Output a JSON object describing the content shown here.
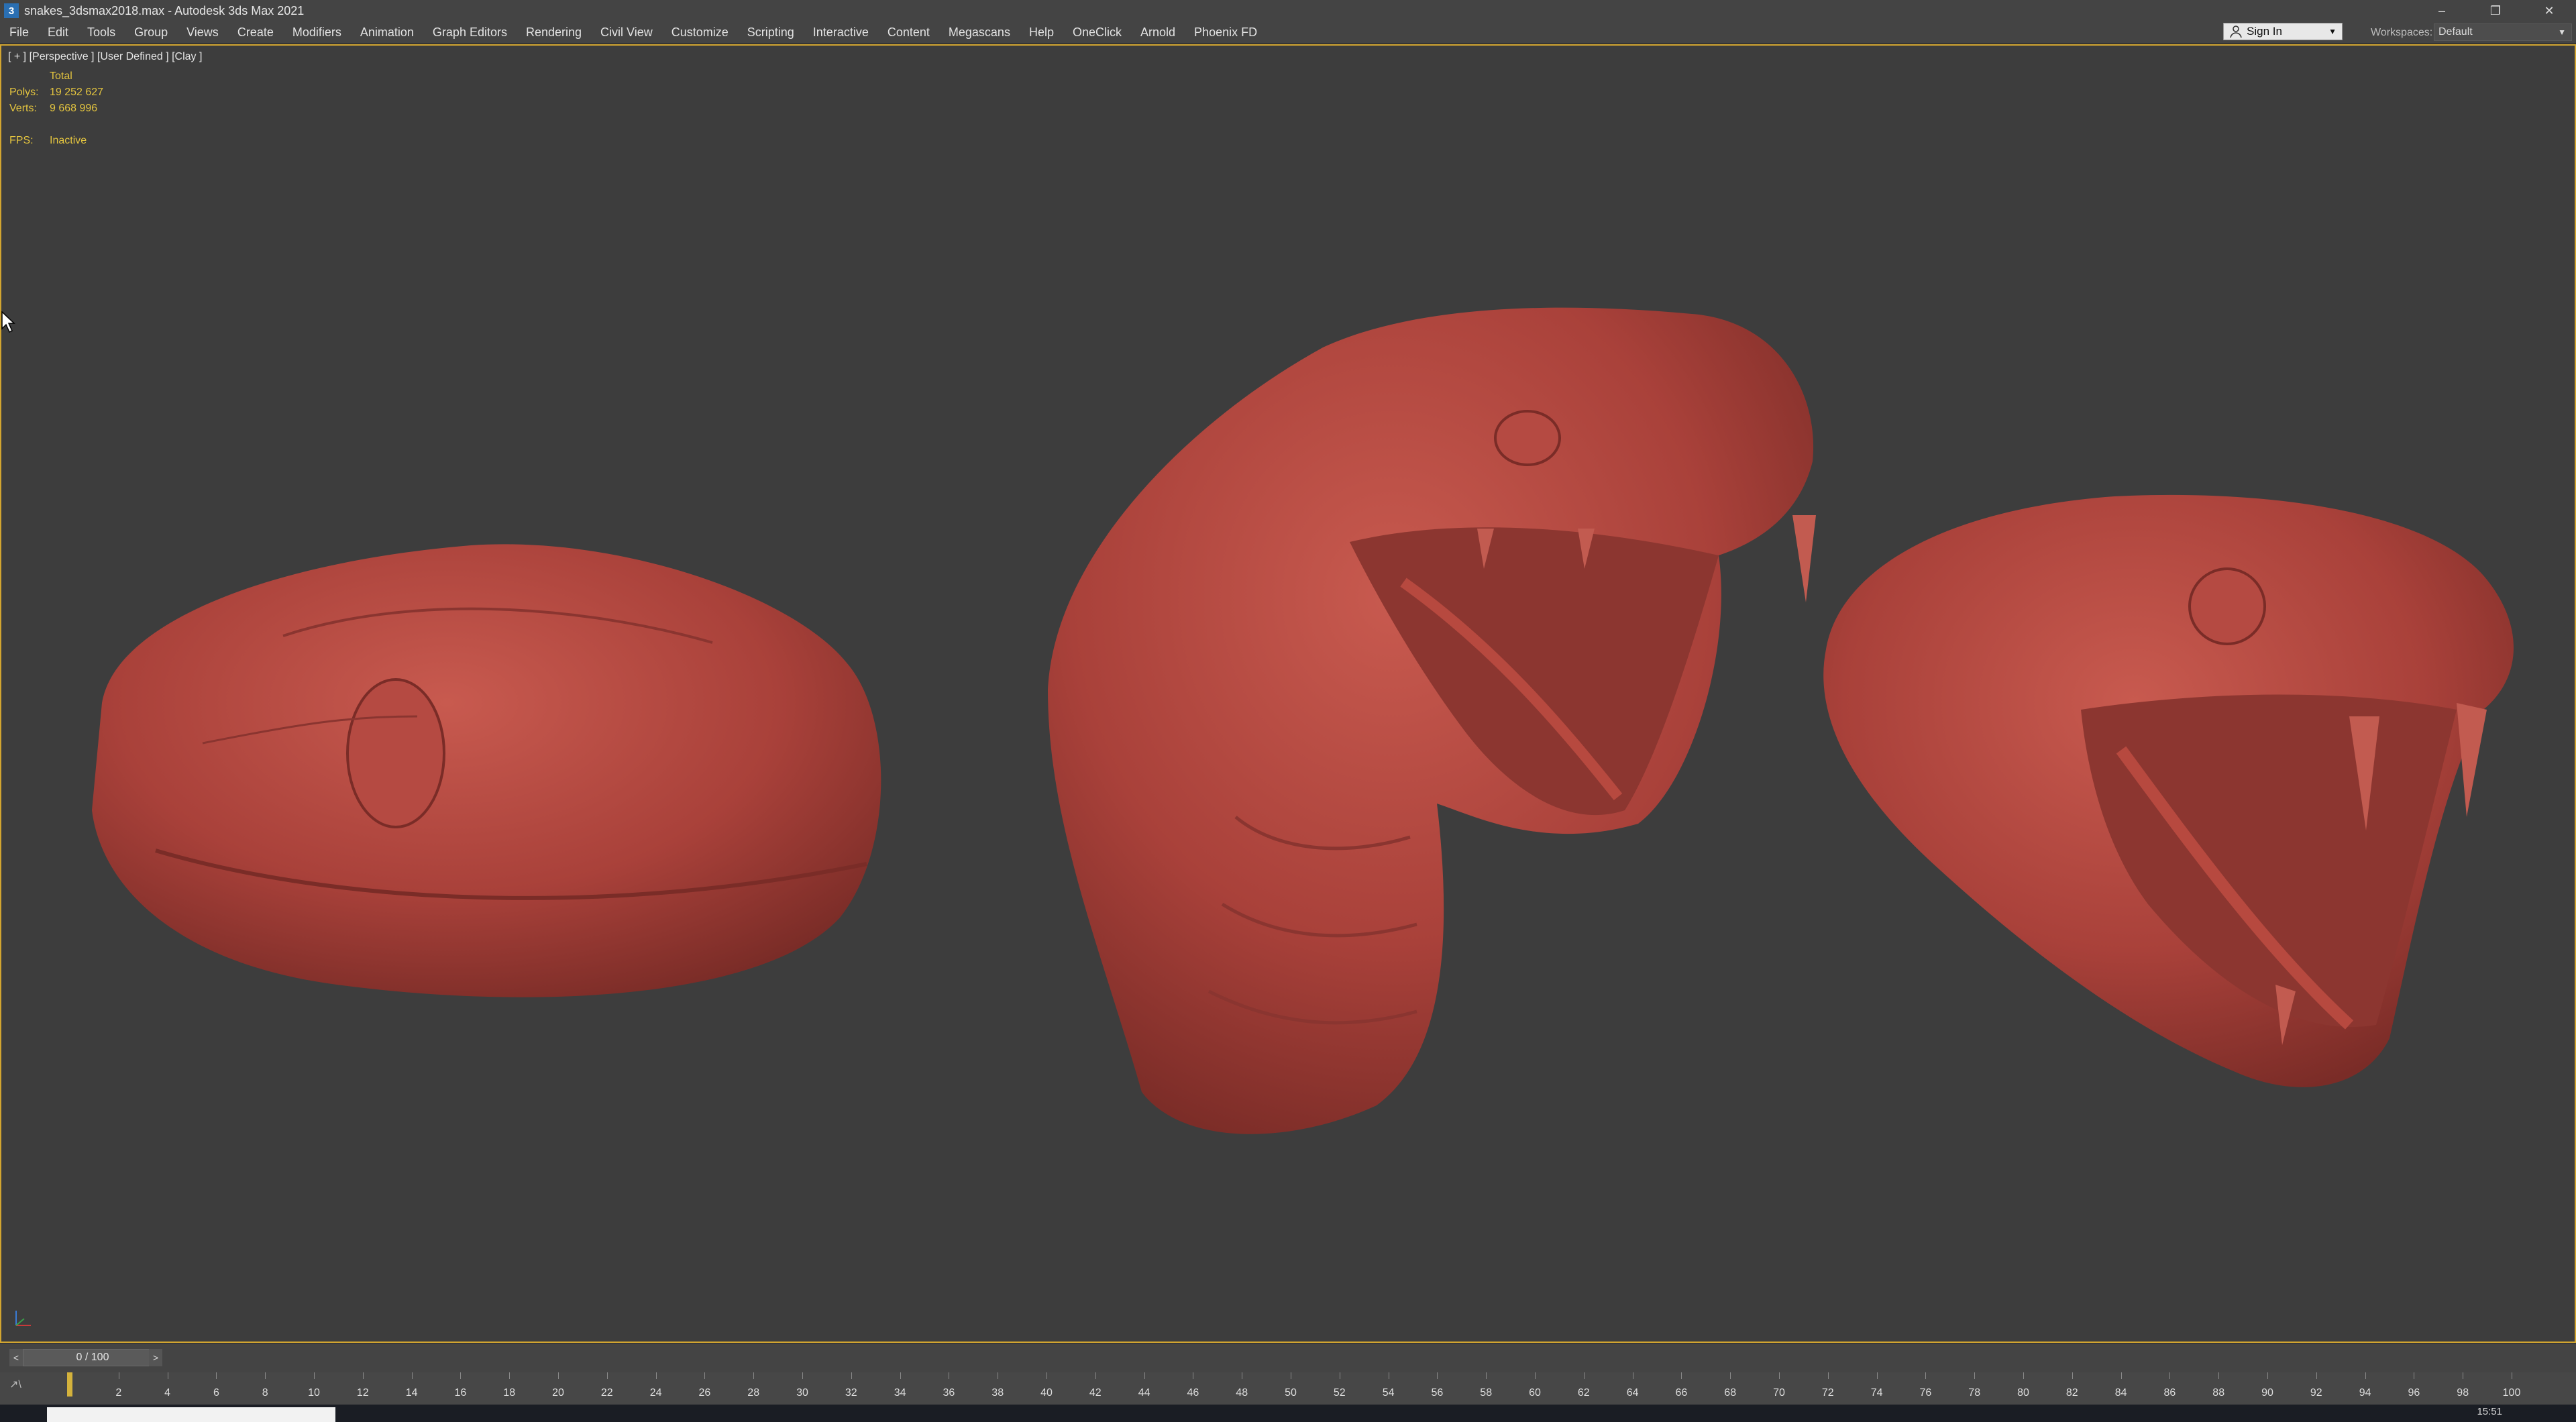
{
  "window": {
    "app_icon": "3",
    "title": "snakes_3dsmax2018.max - Autodesk 3ds Max 2021",
    "minimize": "–",
    "restore": "❐",
    "close": "✕"
  },
  "menu": {
    "items": [
      "File",
      "Edit",
      "Tools",
      "Group",
      "Views",
      "Create",
      "Modifiers",
      "Animation",
      "Graph Editors",
      "Rendering",
      "Civil View",
      "Customize",
      "Scripting",
      "Interactive",
      "Content",
      "Megascans",
      "Help",
      "OneClick",
      "Arnold",
      "Phoenix FD"
    ]
  },
  "account": {
    "sign_in": "Sign In",
    "dropdown_arrow": "▼"
  },
  "workspace": {
    "label": "Workspaces:",
    "value": "Default",
    "dropdown_arrow": "▼"
  },
  "viewport": {
    "label": "[ + ] [Perspective ] [User Defined ] [Clay ]",
    "stats": {
      "header": "Total",
      "polys_label": "Polys:",
      "polys_value": "19 252 627",
      "verts_label": "Verts:",
      "verts_value": "9 668 996",
      "fps_label": "FPS:",
      "fps_value": "Inactive"
    },
    "model_color": "#b8473e"
  },
  "timeslider": {
    "value": "0 / 100",
    "prev": "<",
    "next": ">"
  },
  "trackbar": {
    "icon": "↗\\",
    "ticks": [
      "2",
      "4",
      "6",
      "8",
      "10",
      "12",
      "14",
      "16",
      "18",
      "20",
      "22",
      "24",
      "26",
      "28",
      "30",
      "32",
      "34",
      "36",
      "38",
      "40",
      "42",
      "44",
      "46",
      "48",
      "50",
      "52",
      "54",
      "56",
      "58",
      "60",
      "62",
      "64",
      "66",
      "68",
      "70",
      "72",
      "74",
      "76",
      "78",
      "80",
      "82",
      "84",
      "86",
      "88",
      "90",
      "92",
      "94",
      "96",
      "98",
      "100"
    ]
  },
  "taskbar": {
    "time": "15:51"
  }
}
